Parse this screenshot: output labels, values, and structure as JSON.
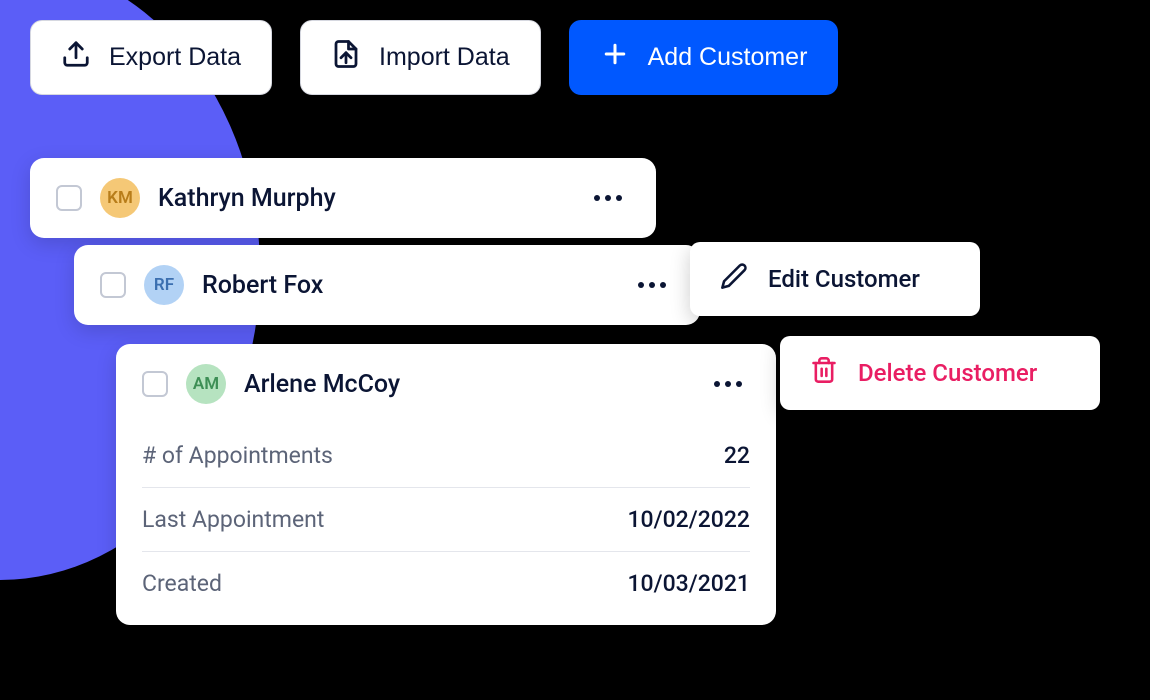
{
  "toolbar": {
    "export_label": "Export Data",
    "import_label": "Import Data",
    "add_label": "Add Customer"
  },
  "customers": [
    {
      "initials": "KM",
      "name": "Kathryn Murphy"
    },
    {
      "initials": "RF",
      "name": "Robert Fox"
    },
    {
      "initials": "AM",
      "name": "Arlene McCoy"
    }
  ],
  "details": {
    "appointments_label": "# of Appointments",
    "appointments_value": "22",
    "last_label": "Last Appointment",
    "last_value": "10/02/2022",
    "created_label": "Created",
    "created_value": "10/03/2021"
  },
  "menu": {
    "edit_label": "Edit Customer",
    "delete_label": "Delete Customer"
  }
}
